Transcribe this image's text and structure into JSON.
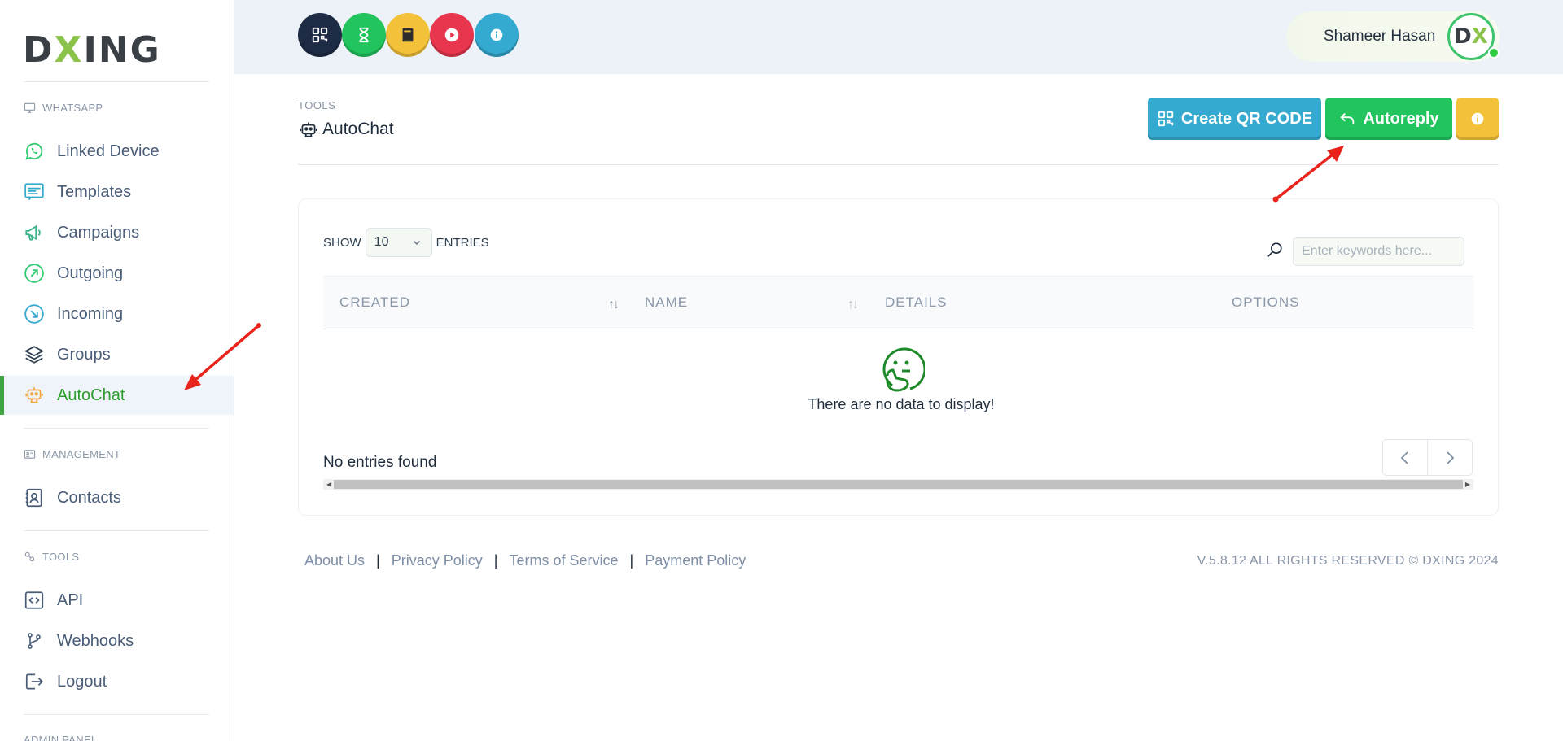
{
  "sidebar": {
    "logo": {
      "prefix": "D",
      "accent": "X",
      "suffix": "ING"
    },
    "sections": [
      {
        "label": "WHATSAPP",
        "icon": "monitor-icon"
      },
      {
        "label": "MANAGEMENT",
        "icon": "id-card-icon"
      },
      {
        "label": "TOOLS",
        "icon": "tools-icon"
      },
      {
        "label": "ADMIN PANEL",
        "icon": ""
      }
    ],
    "items": [
      {
        "label": "Linked Device",
        "icon": "whatsapp-icon"
      },
      {
        "label": "Templates",
        "icon": "template-icon"
      },
      {
        "label": "Campaigns",
        "icon": "megaphone-icon"
      },
      {
        "label": "Outgoing",
        "icon": "arrow-up-right-icon"
      },
      {
        "label": "Incoming",
        "icon": "arrow-down-right-icon"
      },
      {
        "label": "Groups",
        "icon": "layers-icon"
      },
      {
        "label": "AutoChat",
        "icon": "robot-icon",
        "active": true
      },
      {
        "label": "Contacts",
        "icon": "contacts-icon"
      },
      {
        "label": "API",
        "icon": "code-icon"
      },
      {
        "label": "Webhooks",
        "icon": "git-branch-icon"
      },
      {
        "label": "Logout",
        "icon": "logout-icon"
      }
    ]
  },
  "topbar": {
    "quick_buttons": [
      {
        "name": "qr-code",
        "color": "#1d2b44"
      },
      {
        "name": "hourglass",
        "color": "#22c45e"
      },
      {
        "name": "book",
        "color": "#f4c13a"
      },
      {
        "name": "play",
        "color": "#e8364f"
      },
      {
        "name": "info",
        "color": "#34aad0"
      }
    ],
    "user": {
      "name": "Shameer Hasan",
      "avatar": {
        "prefix": "D",
        "accent": "X"
      },
      "status_color": "#2ecc40"
    }
  },
  "page": {
    "breadcrumb": "TOOLS",
    "title": "AutoChat",
    "buttons": {
      "qr": "Create QR CODE",
      "autoreply": "Autoreply"
    }
  },
  "table": {
    "show_label": "SHOW",
    "entries_value": "10",
    "entries_label": "ENTRIES",
    "search_placeholder": "Enter keywords here...",
    "columns": [
      "CREATED",
      "NAME",
      "DETAILS",
      "OPTIONS"
    ],
    "empty_message": "There are no data to display!",
    "info": "No entries found"
  },
  "footer": {
    "links": [
      "About Us",
      "Privacy Policy",
      "Terms of Service",
      "Payment Policy"
    ],
    "copyright": "V.5.8.12 ALL RIGHTS RESERVED © DXING 2024"
  },
  "colors": {
    "brand_green": "#8bc34a",
    "active_green": "#2e9b2e",
    "qr_button": "#34aad0",
    "autoreply_button": "#22c45e",
    "info_button": "#f4c13a",
    "annotation_arrow": "#e8231c"
  }
}
